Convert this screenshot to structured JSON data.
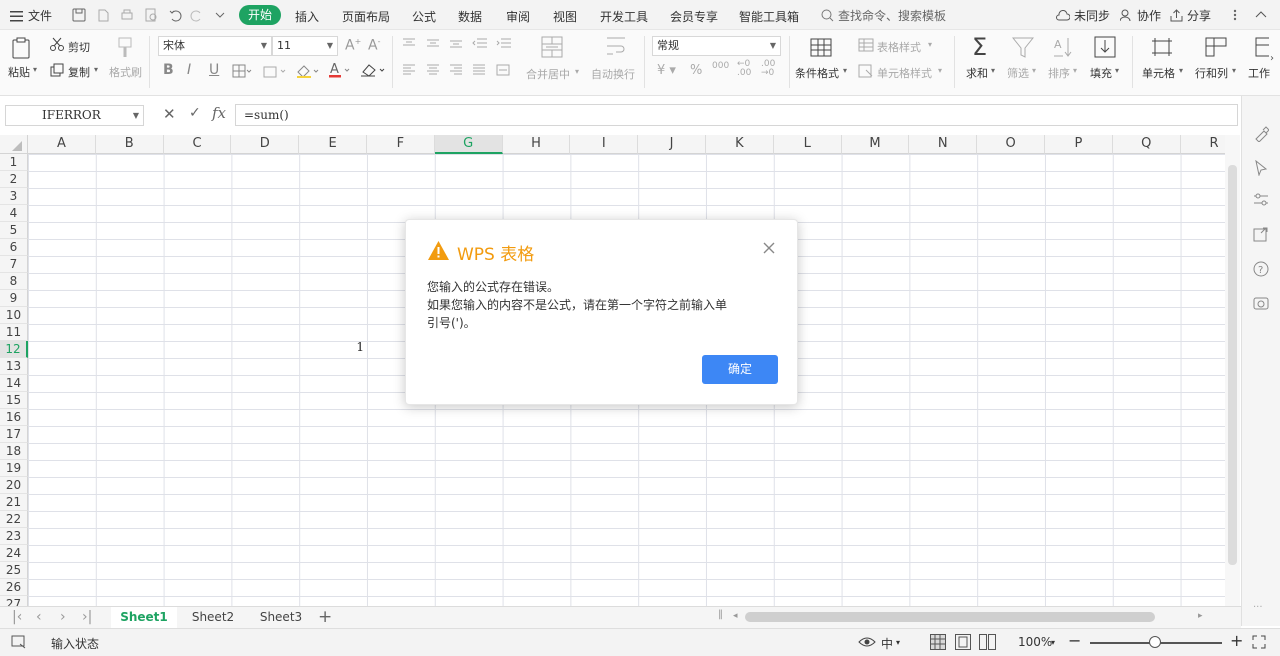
{
  "menubar": {
    "file": "文件",
    "tabs": [
      "开始",
      "插入",
      "页面布局",
      "公式",
      "数据",
      "审阅",
      "视图",
      "开发工具",
      "会员专享",
      "智能工具箱"
    ],
    "search_placeholder": "查找命令、搜索模板",
    "sync": "未同步",
    "collab": "协作",
    "share": "分享"
  },
  "ribbon": {
    "paste": "粘贴",
    "cut": "剪切",
    "copy": "复制",
    "format_painter": "格式刷",
    "font_name": "宋体",
    "font_size": "11",
    "merge_center": "合并居中",
    "wrap_text": "自动换行",
    "number_format": "常规",
    "conditional_format": "条件格式",
    "table_style": "表格样式",
    "cell_style": "单元格样式",
    "sum": "求和",
    "filter": "筛选",
    "sort": "排序",
    "fill": "填充",
    "cell": "单元格",
    "row_col": "行和列",
    "worksheet": "工作"
  },
  "formula_bar": {
    "name_box": "IFERROR",
    "formula": "=sum()",
    "fx": "fx"
  },
  "grid": {
    "columns": [
      "A",
      "B",
      "C",
      "D",
      "E",
      "F",
      "G",
      "H",
      "I",
      "J",
      "K",
      "L",
      "M",
      "N",
      "O",
      "P",
      "Q",
      "R"
    ],
    "active_column": "G",
    "rows": [
      "1",
      "2",
      "3",
      "4",
      "5",
      "6",
      "7",
      "8",
      "9",
      "10",
      "11",
      "12",
      "13",
      "14",
      "15",
      "16",
      "17",
      "18",
      "19",
      "20",
      "21",
      "22",
      "23",
      "24",
      "25",
      "26",
      "27"
    ],
    "active_row": "12",
    "cell_E12": "1"
  },
  "sheets": [
    "Sheet1",
    "Sheet2",
    "Sheet3"
  ],
  "active_sheet": "Sheet1",
  "status": {
    "mode": "输入状态",
    "zoom": "100%",
    "lang": "中"
  },
  "dialog": {
    "title": "WPS 表格",
    "line1": "您输入的公式存在错误。",
    "line2": "如果您输入的内容不是公式，请在第一个字符之前输入单",
    "line3": "引号(')。",
    "ok": "确定"
  },
  "colors": {
    "accent_green": "#1ea362",
    "button_blue": "#3d87f5",
    "warning_orange": "#f29b0f"
  }
}
